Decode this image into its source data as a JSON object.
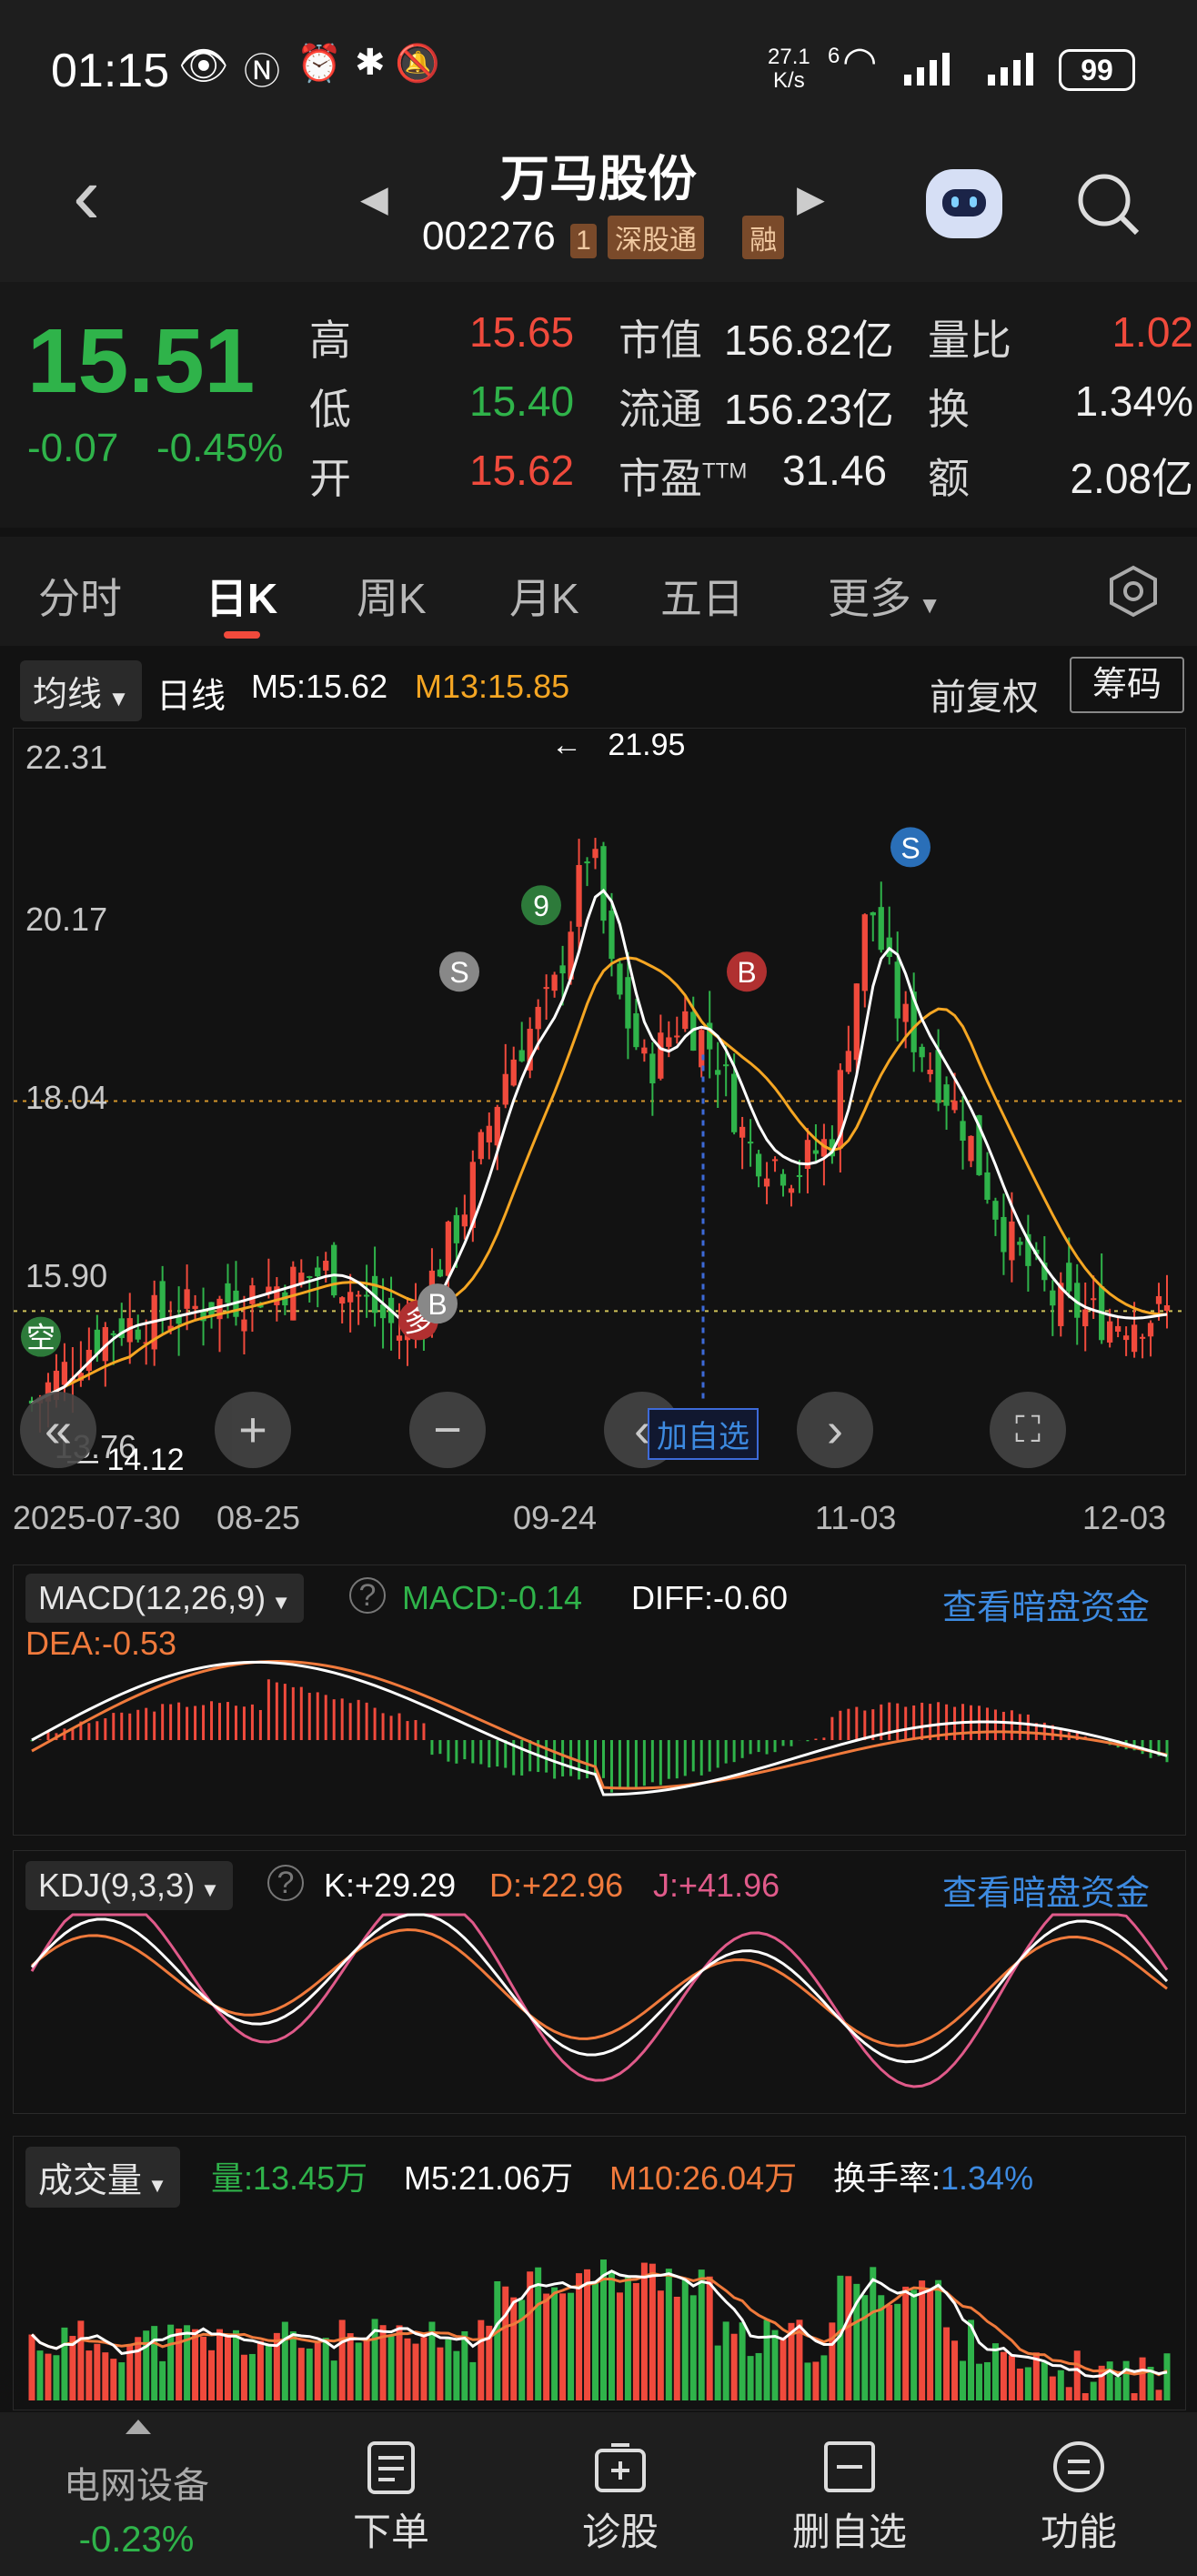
{
  "status_bar": {
    "time": "01:15",
    "net_speed_top": "27.1",
    "net_speed_unit": "K/s",
    "wifi_label": "6",
    "battery": "99"
  },
  "header": {
    "title": "万马股份",
    "code": "002276",
    "level_badge": "1",
    "tag_sgt": "深股通",
    "tag_rong": "融"
  },
  "quote": {
    "price": "15.51",
    "change": "-0.07",
    "change_pct": "-0.45%",
    "high_label": "高",
    "high": "15.65",
    "low_label": "低",
    "low": "15.40",
    "open_label": "开",
    "open": "15.62",
    "mktcap_label": "市值",
    "mktcap": "156.82亿",
    "float_label": "流通",
    "float": "156.23亿",
    "pe_label": "市盈",
    "pe_sup": "TTM",
    "pe": "31.46",
    "vol_ratio_label": "量比",
    "vol_ratio": "1.02",
    "turnover_label": "换",
    "turnover": "1.34%",
    "amount_label": "额",
    "amount": "2.08亿"
  },
  "tabs": [
    "分时",
    "日K",
    "周K",
    "月K",
    "五日",
    "更多"
  ],
  "indicator_bar": {
    "ma_chip": "均线",
    "period": "日线",
    "m5": "M5:15.62",
    "m13": "M13:15.85",
    "fq": "前复权",
    "chip_btn": "筹码"
  },
  "kline": {
    "y_ticks": [
      "22.31",
      "20.17",
      "18.04",
      "15.90"
    ],
    "low_label": "13.76",
    "max_label": "21.95",
    "min_label": "14.12",
    "x_ticks": [
      "2025-07-30",
      "08-25",
      "09-24",
      "11-03",
      "12-03"
    ],
    "add_watch": "加自选",
    "signals": [
      {
        "t": "空",
        "c": "#2d7a3a"
      },
      {
        "t": "多",
        "c": "#b03030"
      },
      {
        "t": "B",
        "c": "#888"
      },
      {
        "t": "S",
        "c": "#888"
      },
      {
        "t": "S",
        "c": "#2a6fb8"
      },
      {
        "t": "B",
        "c": "#b03030"
      },
      {
        "t": "9",
        "c": "#2d7a3a"
      }
    ],
    "ma5_color": "#ffffff",
    "ma13_color": "#f5a623"
  },
  "chart_data": {
    "type": "candlestick",
    "x_ticks": [
      "2025-07-30",
      "08-25",
      "09-24",
      "11-03",
      "12-03"
    ],
    "y_ticks": [
      22.31,
      20.17,
      18.04,
      15.9
    ],
    "ylim": [
      13.76,
      22.31
    ],
    "max_price": 21.95,
    "min_price": 14.12,
    "last": {
      "m5": 15.62,
      "m13": 15.85
    }
  },
  "macd": {
    "label": "MACD(12,26,9)",
    "macd": "MACD:-0.14",
    "diff": "DIFF:-0.60",
    "dea": "DEA:-0.53",
    "link": "查看暗盘资金"
  },
  "kdj": {
    "label": "KDJ(9,3,3)",
    "k": "K:+29.29",
    "d": "D:+22.96",
    "j": "J:+41.96",
    "link": "查看暗盘资金"
  },
  "volume": {
    "label": "成交量",
    "vol": "量:13.45万",
    "m5": "M5:21.06万",
    "m10": "M10:26.04万",
    "turnover_label": "换手率:",
    "turnover": "1.34%"
  },
  "bottom_nav": {
    "sector": "电网设备",
    "sector_change": "-0.23%",
    "items": [
      "下单",
      "诊股",
      "删自选",
      "功能"
    ]
  }
}
